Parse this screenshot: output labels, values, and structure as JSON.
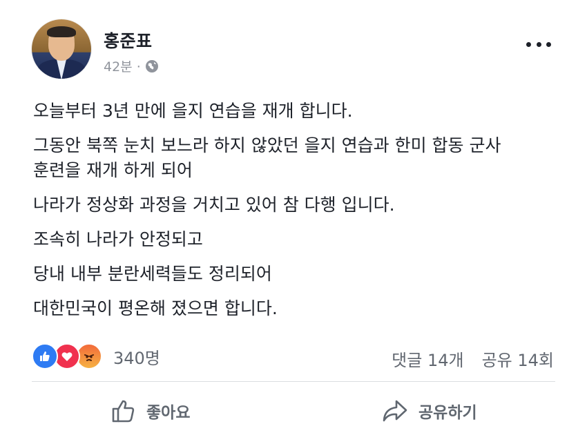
{
  "post": {
    "author": "홍준표",
    "time": "42분 ·",
    "paragraphs": [
      "오늘부터 3년 만에 을지 연습을 재개 합니다.",
      "그동안 북쪽 눈치 보느라 하지 않았던 을지 연습과 한미 합동 군사\n훈련을 재개 하게 되어",
      "나라가 정상화 과정을 거치고 있어 참 다행 입니다.",
      "조속히 나라가 안정되고",
      "당내 내부 분란세력들도 정리되어",
      "대한민국이 평온해 졌으면 합니다."
    ],
    "reactions": {
      "types": [
        "like-icon",
        "love-icon",
        "angry-icon"
      ],
      "count": "340명"
    },
    "comments": "댓글 14개",
    "shares": "공유 14회",
    "actions": {
      "like_label": "좋아요",
      "share_label": "공유하기"
    }
  },
  "colors": {
    "like": "#2e7bf3",
    "love": "#f0314e",
    "angry": "#f26b3a",
    "meta_text": "#90949c",
    "action_text": "#606770"
  }
}
